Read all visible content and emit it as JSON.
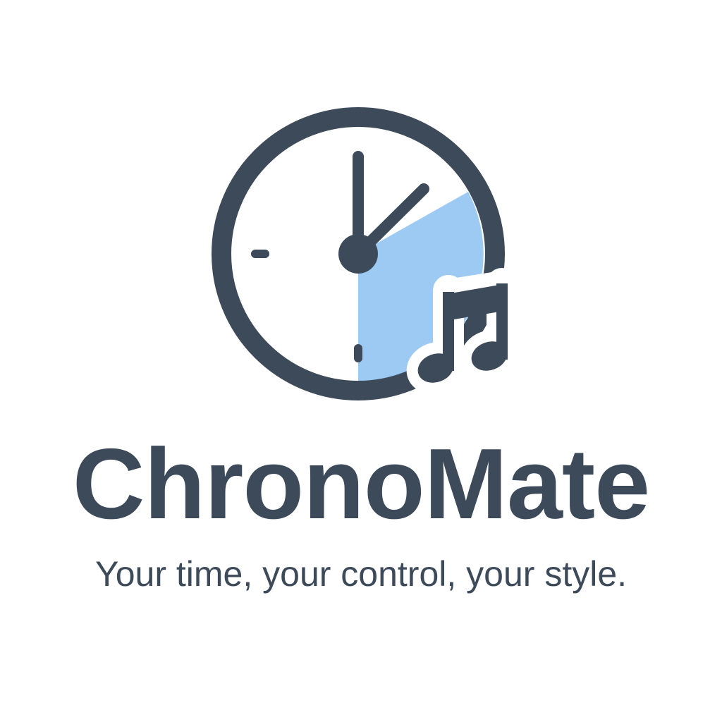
{
  "brand": {
    "name": "ChronoMate",
    "tagline": "Your time, your control, your style."
  },
  "logo": {
    "icons": [
      "clock-icon",
      "music-note-icon"
    ]
  },
  "colors": {
    "ink": "#3d4a59",
    "accent": "#9ccaf3",
    "background": "#ffffff"
  }
}
